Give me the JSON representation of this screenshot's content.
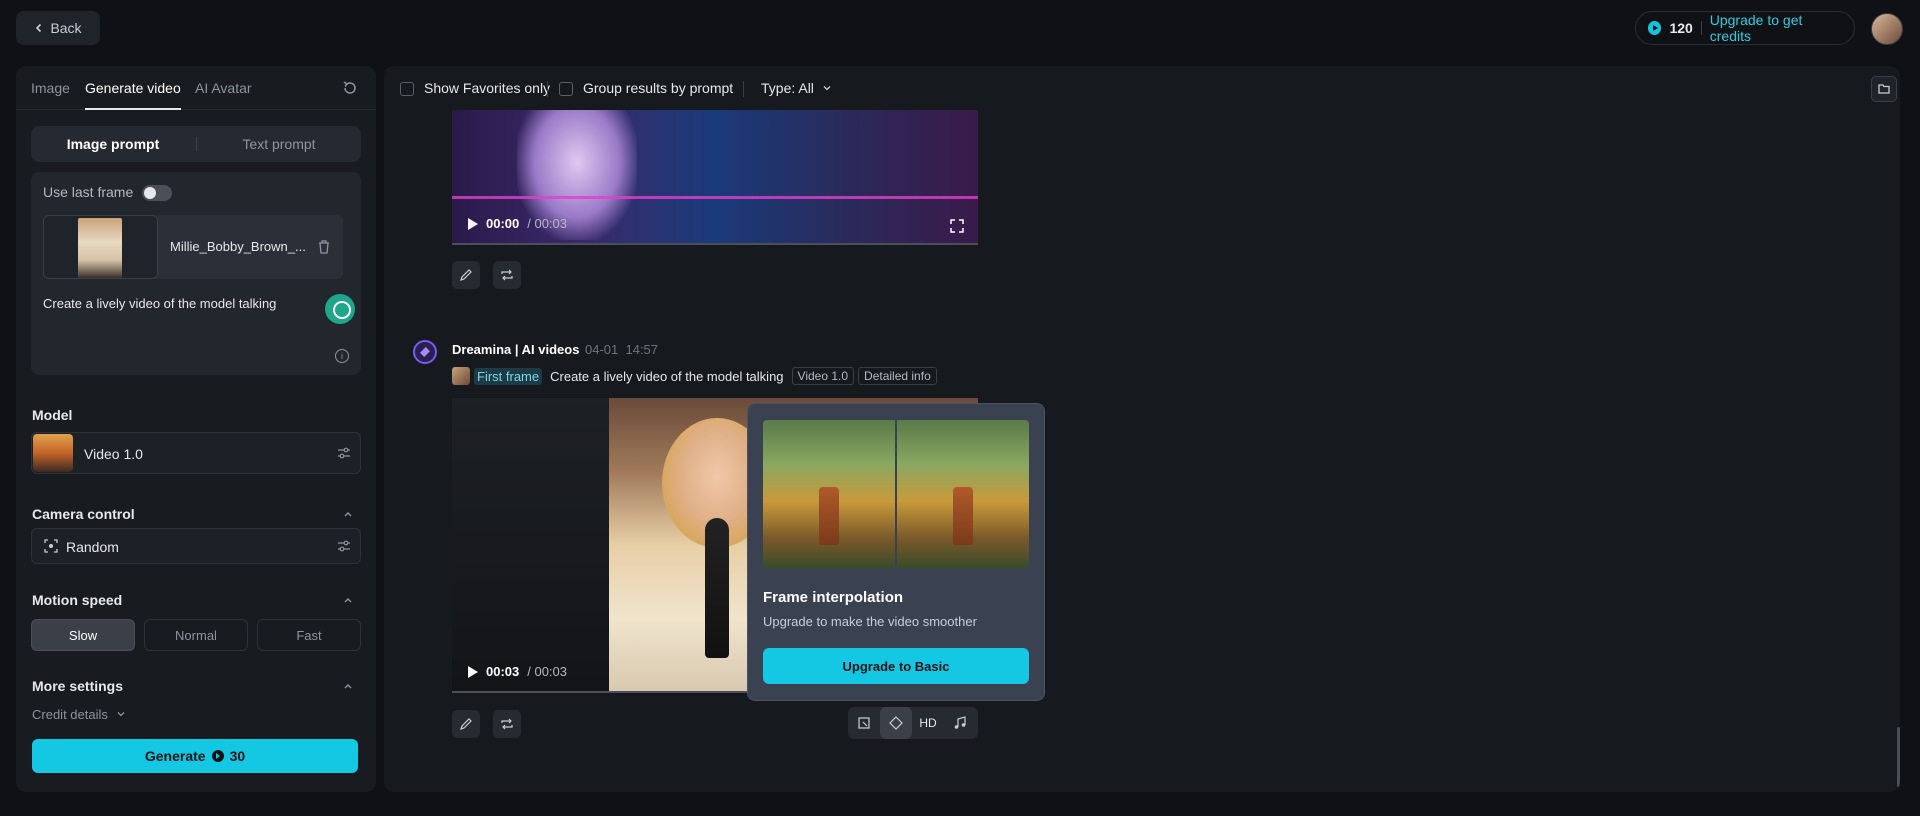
{
  "topbar": {
    "back_label": "Back",
    "credits": "120",
    "upgrade_link": "Upgrade to get credits"
  },
  "left": {
    "tabs": [
      {
        "label": "Image"
      },
      {
        "label": "Generate video"
      },
      {
        "label": "AI Avatar"
      }
    ],
    "prompt_modes": [
      {
        "label": "Image prompt"
      },
      {
        "label": "Text prompt"
      }
    ],
    "use_last_frame_label": "Use last frame",
    "use_last_frame_on": false,
    "file_name": "Millie_Bobby_Brown_...",
    "prompt_text": "Create a lively video of the model talking",
    "model_label": "Model",
    "model_value": "Video 1.0",
    "camera_label": "Camera control",
    "camera_value": "Random",
    "motion_label": "Motion speed",
    "motion_options": [
      {
        "label": "Slow"
      },
      {
        "label": "Normal"
      },
      {
        "label": "Fast"
      }
    ],
    "more_settings_label": "More settings",
    "credit_details_label": "Credit details",
    "generate_label": "Generate",
    "generate_cost": "30"
  },
  "main": {
    "filters": {
      "favorites_label": "Show Favorites only",
      "group_label": "Group results by prompt",
      "type_label": "Type: All"
    },
    "video1": {
      "time_current": "00:00",
      "time_total": "/ 00:03"
    },
    "generation": {
      "title": "Dreamina | AI videos",
      "date": "04-01",
      "time": "14:57",
      "first_frame_label": "First frame",
      "prompt": "Create a lively video of the model talking",
      "tag_model": "Video 1.0",
      "tag_info": "Detailed info"
    },
    "video2": {
      "time_current": "00:03",
      "time_total": "/ 00:03"
    },
    "tooltip": {
      "title": "Frame interpolation",
      "subtitle": "Upgrade to make the video smoother",
      "button": "Upgrade to Basic"
    },
    "tools": {
      "hd_label": "HD"
    }
  },
  "colors": {
    "accent": "#14c8e3",
    "bg": "#0f1115",
    "panel": "#181b20"
  }
}
